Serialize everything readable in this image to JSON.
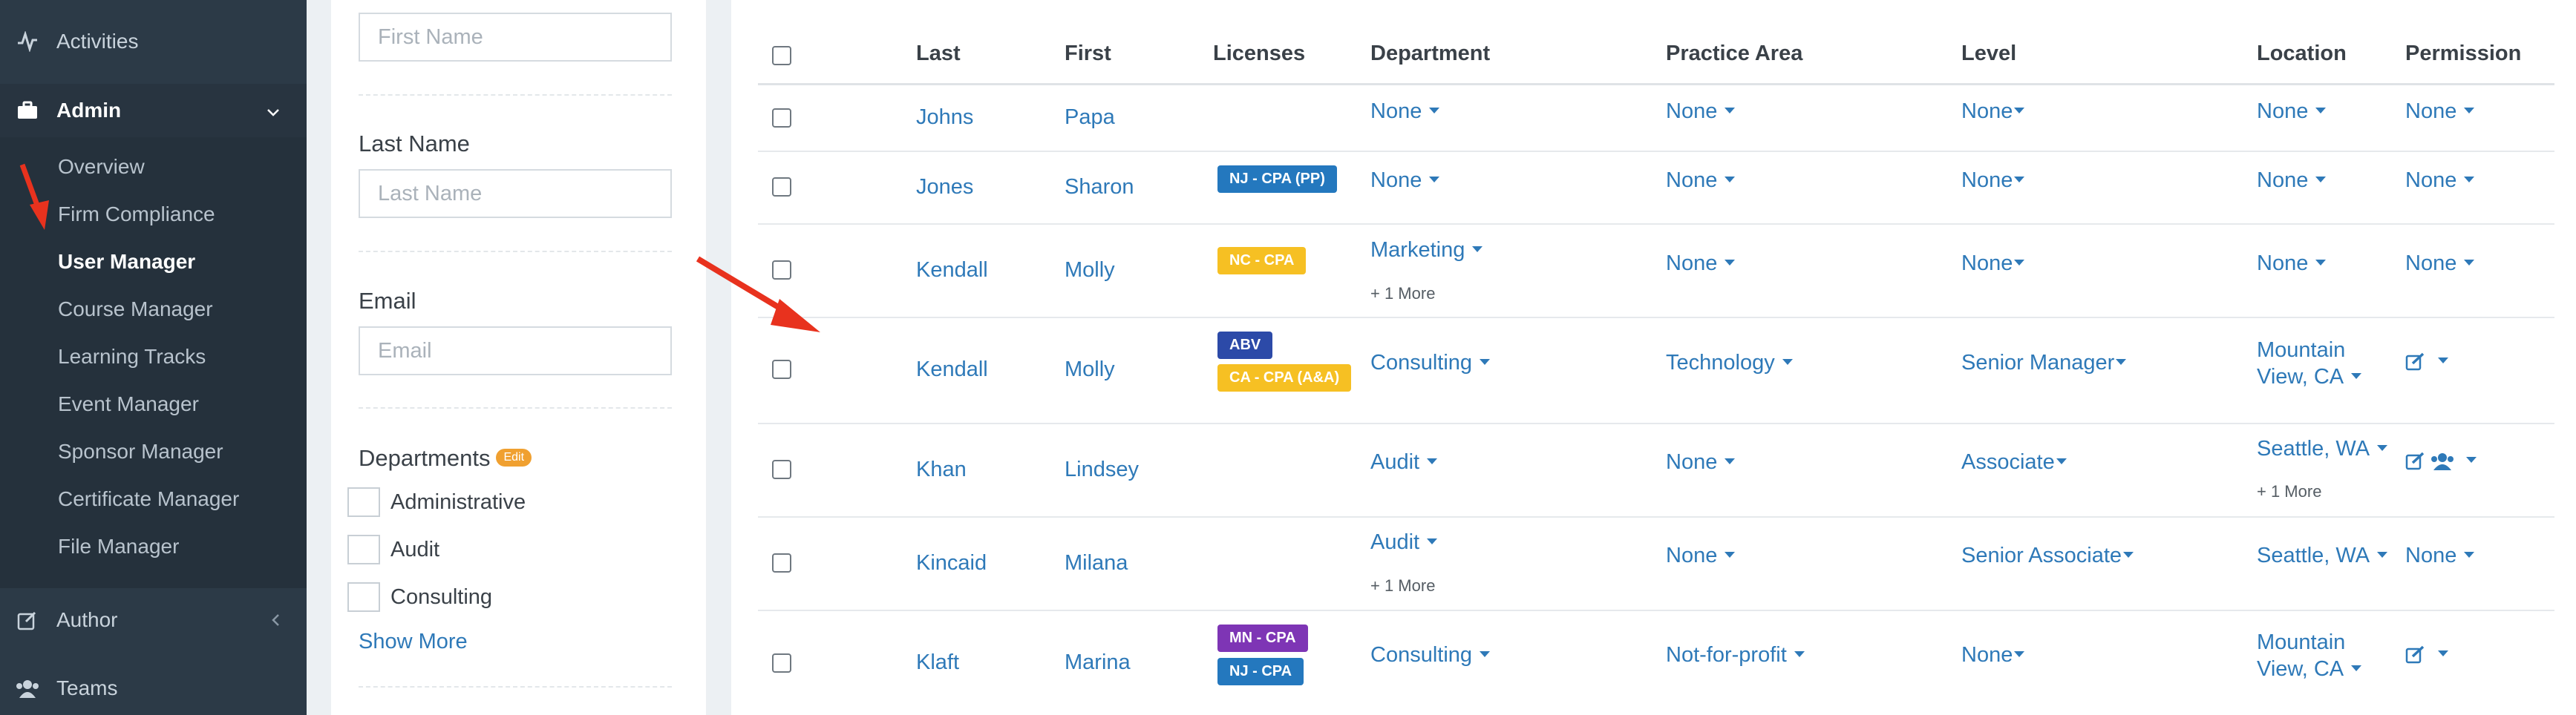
{
  "sidebar": {
    "activities_label": "Activities",
    "admin_label": "Admin",
    "admin_items": [
      {
        "label": "Overview"
      },
      {
        "label": "Firm Compliance"
      },
      {
        "label": "User Manager"
      },
      {
        "label": "Course Manager"
      },
      {
        "label": "Learning Tracks"
      },
      {
        "label": "Event Manager"
      },
      {
        "label": "Sponsor Manager"
      },
      {
        "label": "Certificate Manager"
      },
      {
        "label": "File Manager"
      }
    ],
    "author_label": "Author",
    "teams_label": "Teams"
  },
  "filters": {
    "first_name_placeholder": "First Name",
    "last_name_label": "Last Name",
    "last_name_placeholder": "Last Name",
    "email_label": "Email",
    "email_placeholder": "Email",
    "departments_label": "Departments",
    "edit_badge": "Edit",
    "departments": [
      {
        "label": "Administrative"
      },
      {
        "label": "Audit"
      },
      {
        "label": "Consulting"
      }
    ],
    "show_more": "Show More"
  },
  "table": {
    "headers": {
      "last": "Last",
      "first": "First",
      "licenses": "Licenses",
      "department": "Department",
      "practice_area": "Practice Area",
      "level": "Level",
      "location": "Location",
      "permission": "Permission"
    },
    "rows": [
      {
        "last": "Johns",
        "first": "Papa",
        "licenses": [],
        "department": "None",
        "department_more": "",
        "practice_area": "None",
        "level": "None",
        "location": "None",
        "location_more": "",
        "permission": "None"
      },
      {
        "last": "Jones",
        "first": "Sharon",
        "licenses": [
          "NJ - CPA (PP)"
        ],
        "department": "None",
        "department_more": "",
        "practice_area": "None",
        "level": "None",
        "location": "None",
        "location_more": "",
        "permission": "None"
      },
      {
        "last": "Kendall",
        "first": "Molly",
        "licenses": [
          "NC - CPA"
        ],
        "department": "Marketing",
        "department_more": "+ 1 More",
        "practice_area": "None",
        "level": "None",
        "location": "None",
        "location_more": "",
        "permission": "None"
      },
      {
        "last": "Kendall",
        "first": "Molly",
        "licenses": [
          "ABV",
          "CA - CPA (A&A)"
        ],
        "department": "Consulting",
        "department_more": "",
        "practice_area": "Technology",
        "level": "Senior Manager",
        "location_line1": "Mountain",
        "location_line2": "View, CA",
        "location_more": "",
        "permission": "edit-icon"
      },
      {
        "last": "Khan",
        "first": "Lindsey",
        "licenses": [],
        "department": "Audit",
        "department_more": "",
        "practice_area": "None",
        "level": "Associate",
        "location": "Seattle, WA",
        "location_more": "+ 1 More",
        "permission": "edit-group-icons"
      },
      {
        "last": "Kincaid",
        "first": "Milana",
        "licenses": [],
        "department": "Audit",
        "department_more": "+ 1 More",
        "practice_area": "None",
        "level": "Senior Associate",
        "location": "Seattle, WA",
        "location_more": "",
        "permission": "None"
      },
      {
        "last": "Klaft",
        "first": "Marina",
        "licenses": [
          "MN - CPA",
          "NJ - CPA"
        ],
        "department": "Consulting",
        "department_more": "",
        "practice_area": "Not-for-profit",
        "level": "None",
        "location_line1": "Mountain",
        "location_line2": "View, CA",
        "location_more": "",
        "permission": "edit-icon"
      }
    ]
  },
  "colors": {
    "sidebar_bg": "#2c3a47",
    "link_blue": "#2e79b8",
    "badge_blue": "#2478be",
    "badge_yellow": "#f6c023",
    "badge_purple": "#7e35b5",
    "badge_navy": "#2c4aa8",
    "edit_badge": "#f0a030",
    "annotation_arrow": "#e8321e"
  }
}
